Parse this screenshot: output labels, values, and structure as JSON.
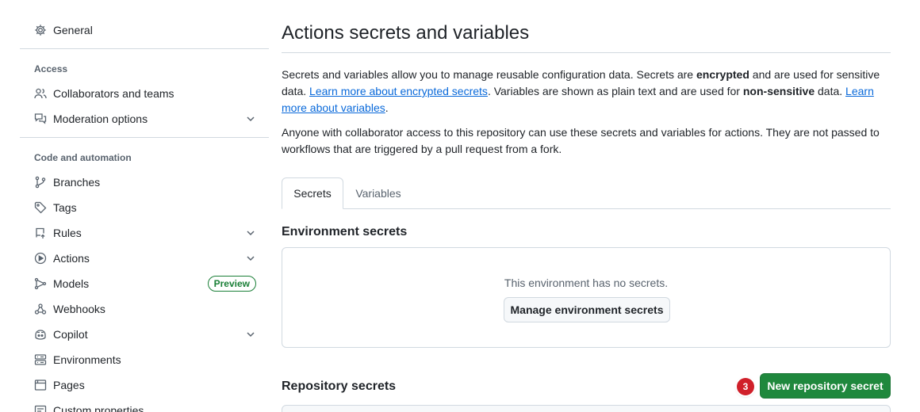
{
  "sidebar": {
    "general": "General",
    "access_heading": "Access",
    "collaborators": "Collaborators and teams",
    "moderation": "Moderation options",
    "code_heading": "Code and automation",
    "branches": "Branches",
    "tags": "Tags",
    "rules": "Rules",
    "actions": "Actions",
    "models": "Models",
    "models_badge": "Preview",
    "webhooks": "Webhooks",
    "copilot": "Copilot",
    "environments": "Environments",
    "pages": "Pages",
    "custom_properties": "Custom properties"
  },
  "main": {
    "title": "Actions secrets and variables",
    "intro": {
      "p1_a": "Secrets and variables allow you to manage reusable configuration data. Secrets are ",
      "p1_b": "encrypted",
      "p1_c": " and are used for sensitive data. ",
      "p1_link1": "Learn more about encrypted secrets",
      "p1_d": ". Variables are shown as plain text and are used for ",
      "p1_e": "non-sensitive",
      "p1_f": " data. ",
      "p1_link2": "Learn more about variables",
      "p1_g": ".",
      "p2": "Anyone with collaborator access to this repository can use these secrets and variables for actions. They are not passed to workflows that are triggered by a pull request from a fork."
    },
    "tabs": [
      "Secrets",
      "Variables"
    ],
    "env_heading": "Environment secrets",
    "env_empty": "This environment has no secrets.",
    "env_button": "Manage environment secrets",
    "repo_heading": "Repository secrets",
    "new_secret_button": "New repository secret",
    "step_badge": "3"
  },
  "colors": {
    "accent_link": "#0969da",
    "primary_button": "#1f883d",
    "preview_badge": "#1a7f37",
    "step_badge": "#d0202a"
  },
  "icons": {
    "general": "gear-icon",
    "collaborators": "people-icon",
    "moderation": "comment-discussion-icon",
    "branches": "git-branch-icon",
    "tags": "tag-icon",
    "rules": "repo-push-icon",
    "actions": "play-icon",
    "models": "ai-model-icon",
    "webhooks": "webhook-icon",
    "copilot": "copilot-icon",
    "environments": "server-icon",
    "pages": "browser-icon",
    "custom_properties": "note-icon"
  }
}
